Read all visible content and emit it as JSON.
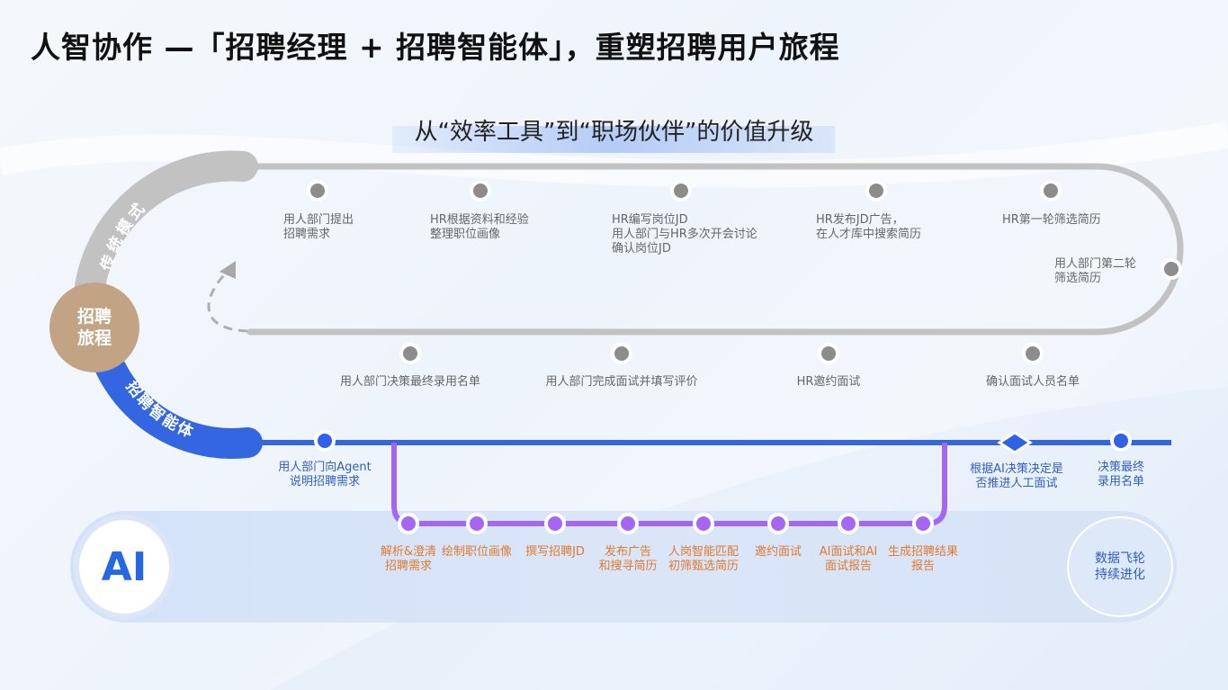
{
  "title": "人智协作 —「招聘经理 + 招聘智能体」，重塑招聘用户旅程",
  "subtitle": "从“效率工具”到“职场伙伴”的价值升级",
  "hub_label": "招聘\n旅程",
  "traditional_label": "传统模式",
  "agent_label": "招聘智能体",
  "ai_label": "AI",
  "flywheel_label": "数据飞轮\n持续进化",
  "traditional_top": [
    "用人部门提出\n招聘需求",
    "HR根据资料和经验\n整理职位画像",
    "HR编写岗位JD\n用人部门与HR多次开会讨论\n确认岗位JD",
    "HR发布JD广告，\n在人才库中搜索简历",
    "HR第一轮筛选简历"
  ],
  "traditional_right": "用人部门第二轮\n筛选简历",
  "traditional_bottom": [
    "确认面试人员名单",
    "HR邀约面试",
    "用人部门完成面试并填写评价",
    "用人部门决策最终录用名单"
  ],
  "agent_main": [
    "用人部门向Agent\n说明招聘需求",
    "根据AI决策决定是\n否推进人工面试",
    "决策最终\n录用名单"
  ],
  "ai_steps": [
    "解析&澄清\n招聘需求",
    "绘制职位画像",
    "撰写招聘JD",
    "发布广告\n和搜寻简历",
    "人岗智能匹配\n初筛甄选简历",
    "邀约面试",
    "AI面试和AI\n面试报告",
    "生成招聘结果\n报告"
  ],
  "colors": {
    "traditional_track": "#c2c2c2",
    "node_gray": "#8c8c8c",
    "agent_track": "#3366e0",
    "ai_track": "#a567f2",
    "hub": "#c2a485"
  }
}
